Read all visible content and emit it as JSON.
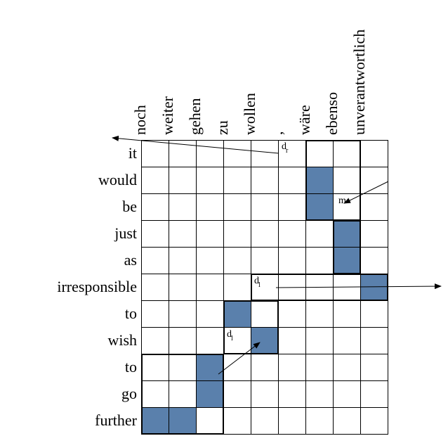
{
  "chart_data": {
    "type": "heatmap",
    "title": "",
    "xlabel": "",
    "ylabel": "",
    "rows": [
      "it",
      "would",
      "be",
      "just",
      "as",
      "irresponsible",
      "to",
      "wish",
      "to",
      "go",
      "further"
    ],
    "cols": [
      "noch",
      "weiter",
      "gehen",
      "zu",
      "wollen",
      ",",
      "wäre",
      "ebenso",
      "unverantwortlich"
    ],
    "alignments": [
      {
        "row": 1,
        "col": 6
      },
      {
        "row": 2,
        "col": 6
      },
      {
        "row": 3,
        "col": 7
      },
      {
        "row": 4,
        "col": 7
      },
      {
        "row": 5,
        "col": 8
      },
      {
        "row": 6,
        "col": 3
      },
      {
        "row": 7,
        "col": 4
      },
      {
        "row": 8,
        "col": 2
      },
      {
        "row": 9,
        "col": 2
      },
      {
        "row": 10,
        "col": 0
      },
      {
        "row": 10,
        "col": 1
      }
    ],
    "annotations": [
      {
        "row": 0,
        "col": 5,
        "label": "dr"
      },
      {
        "row": 2,
        "col": 7,
        "label": "m"
      },
      {
        "row": 5,
        "col": 4,
        "label": "dl"
      },
      {
        "row": 7,
        "col": 3,
        "label": "dl"
      }
    ],
    "fill_color": "#5a80ac"
  },
  "cols": {
    "0": "noch",
    "1": "weiter",
    "2": "gehen",
    "3": "zu",
    "4": "wollen",
    "5": ",",
    "6": "wäre",
    "7": "ebenso",
    "8": "unverantwortlich"
  },
  "rows": {
    "0": "it",
    "1": "would",
    "2": "be",
    "3": "just",
    "4": "as",
    "5": "irresponsible",
    "6": "to",
    "7": "wish",
    "8": "to",
    "9": "go",
    "10": "further"
  },
  "annot": {
    "dr": "d",
    "dr_sub": "r",
    "m": "m",
    "dl1": "d",
    "dl1_sub": "l",
    "dl2": "d",
    "dl2_sub": "l"
  }
}
